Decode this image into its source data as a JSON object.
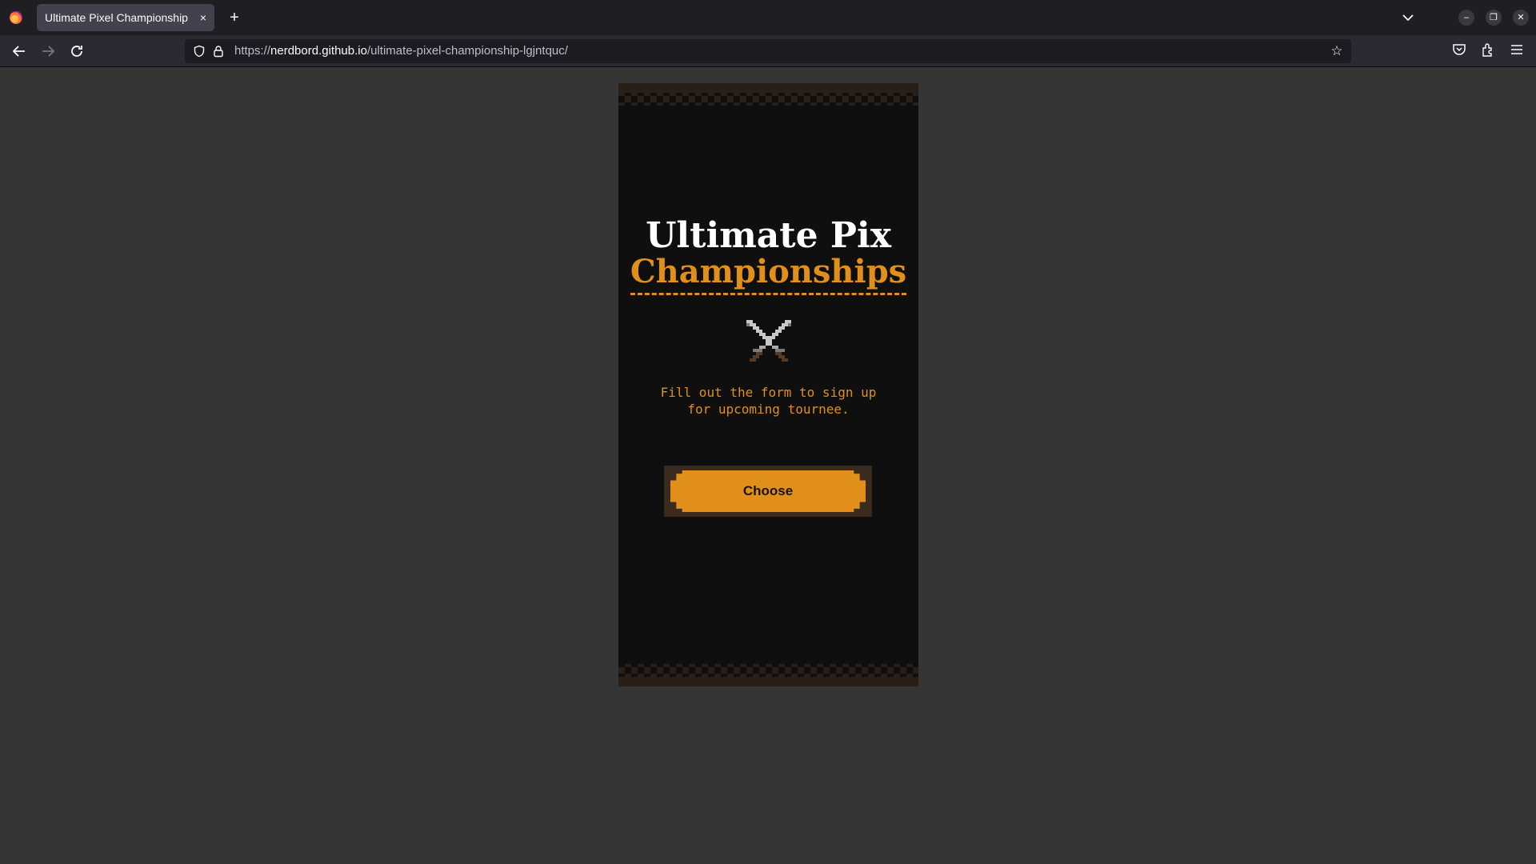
{
  "browser": {
    "tab_title": "Ultimate Pixel Championship",
    "tab_close": "×",
    "new_tab": "+",
    "url_scheme": "https://",
    "url_host": "nerdbord.github.io",
    "url_path": "/ultimate-pixel-championship-lgjntquc/"
  },
  "page": {
    "title_line1": "Ultimate Pix",
    "title_line2": "Championships",
    "subtitle_line1": "Fill out the form to sign up",
    "subtitle_line2": "for upcoming tournee.",
    "button_label": "Choose"
  },
  "colors": {
    "accent": "#e0901a",
    "background": "#353535",
    "card": "#0f0f0f"
  },
  "icons": [
    "firefox-icon",
    "back-icon",
    "forward-icon",
    "reload-icon",
    "shield-icon",
    "lock-icon",
    "star-icon",
    "pocket-icon",
    "extensions-icon",
    "menu-icon",
    "crossed-swords-icon"
  ]
}
